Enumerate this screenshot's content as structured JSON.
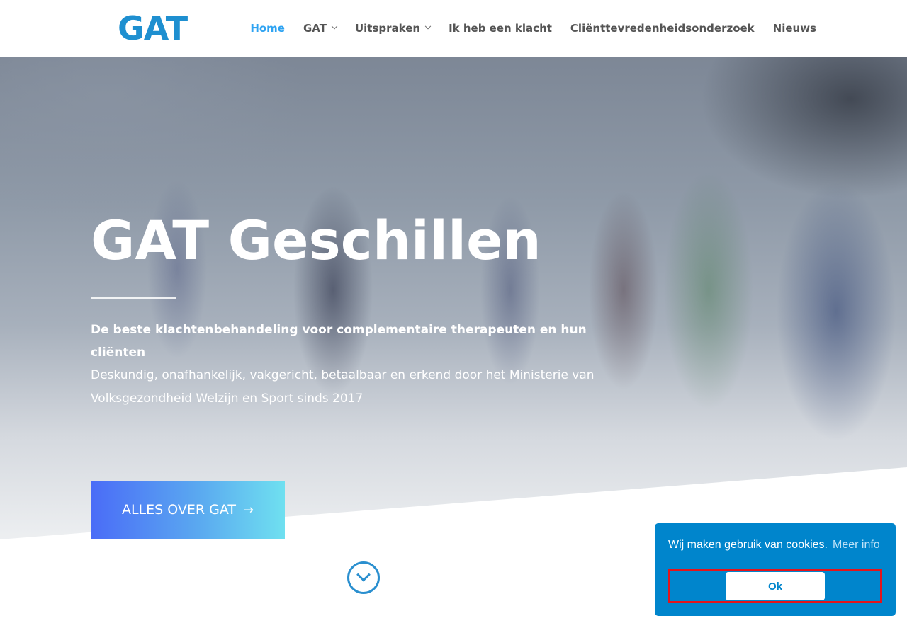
{
  "header": {
    "logo_text": "GAT",
    "nav": [
      {
        "label": "Home",
        "active": true,
        "dropdown": false
      },
      {
        "label": "GAT",
        "active": false,
        "dropdown": true
      },
      {
        "label": "Uitspraken",
        "active": false,
        "dropdown": true
      },
      {
        "label": "Ik heb een klacht",
        "active": false,
        "dropdown": false
      },
      {
        "label": "Cliënttevredenheidsonderzoek",
        "active": false,
        "dropdown": false
      },
      {
        "label": "Nieuws",
        "active": false,
        "dropdown": false
      }
    ]
  },
  "hero": {
    "title": "GAT Geschillen",
    "lead": "De beste klachtenbehandeling voor complementaire therapeuten en hun cliënten",
    "sub": "Deskundig, onafhankelijk, vakgericht, betaalbaar en erkend door het Ministerie van Volksgezondheid Welzijn en Sport sinds 2017",
    "cta_label": "ALLES OVER GAT",
    "cta_arrow": "→"
  },
  "cookie": {
    "text": "Wij maken gebruik van cookies.",
    "link": "Meer info",
    "ok_label": "Ok"
  },
  "icons": {
    "scroll_down": "chevron-down-circle-icon",
    "dropdown": "chevron-down-icon",
    "arrow": "arrow-right-icon"
  },
  "colors": {
    "brand": "#1e8fd0",
    "nav_active": "#2ea3f2",
    "cookie_bg": "#0085cc",
    "focus_outline": "#e4141b"
  }
}
